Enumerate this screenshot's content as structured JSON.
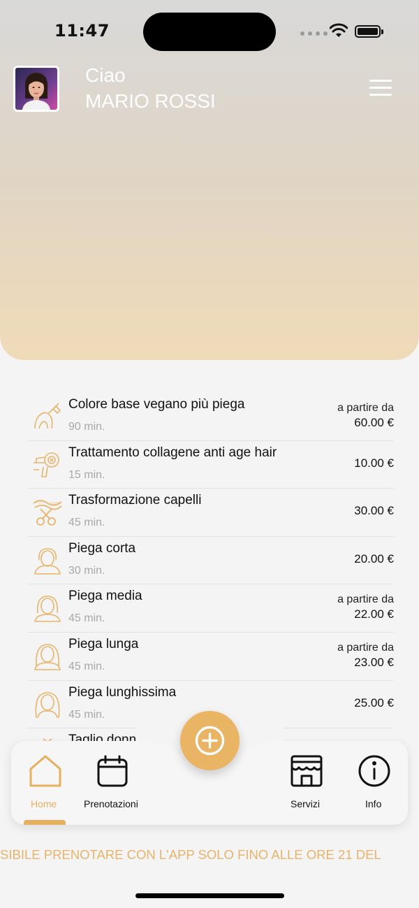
{
  "status_bar": {
    "time": "11:47"
  },
  "header": {
    "greeting": "Ciao",
    "user_name": "MARIO ROSSI"
  },
  "services": [
    {
      "name": "Colore base vegano più piega",
      "duration": "90 min.",
      "price_prefix": "a partire da",
      "price": "60.00 €",
      "icon": "hair-dye-icon"
    },
    {
      "name": "Trattamento collagene anti age hair",
      "duration": "15 min.",
      "price_prefix": "",
      "price": "10.00 €",
      "icon": "hairdryer-icon"
    },
    {
      "name": "Trasformazione capelli",
      "duration": "45 min.",
      "price_prefix": "",
      "price": "30.00 €",
      "icon": "scissors-icon"
    },
    {
      "name": "Piega corta",
      "duration": "30 min.",
      "price_prefix": "",
      "price": "20.00 €",
      "icon": "short-hair-icon"
    },
    {
      "name": "Piega media",
      "duration": "45 min.",
      "price_prefix": "a partire da",
      "price": "22.00 €",
      "icon": "medium-hair-icon"
    },
    {
      "name": "Piega lunga",
      "duration": "45 min.",
      "price_prefix": "a partire da",
      "price": "23.00 €",
      "icon": "long-hair-icon"
    },
    {
      "name": "Piega lunghissima",
      "duration": "45 min.",
      "price_prefix": "",
      "price": "25.00 €",
      "icon": "very-long-hair-icon"
    },
    {
      "name": "Taglio donna",
      "duration": "",
      "price_prefix": "",
      "price": "",
      "icon": "haircut-icon"
    }
  ],
  "tabbar": {
    "home": "Home",
    "bookings": "Prenotazioni",
    "services": "Servizi",
    "info": "Info"
  },
  "ticker": "SIBILE PRENOTARE CON L'APP SOLO FINO ALLE ORE 21 DEL",
  "colors": {
    "accent": "#e9b463",
    "accent_text": "#e5b060"
  }
}
